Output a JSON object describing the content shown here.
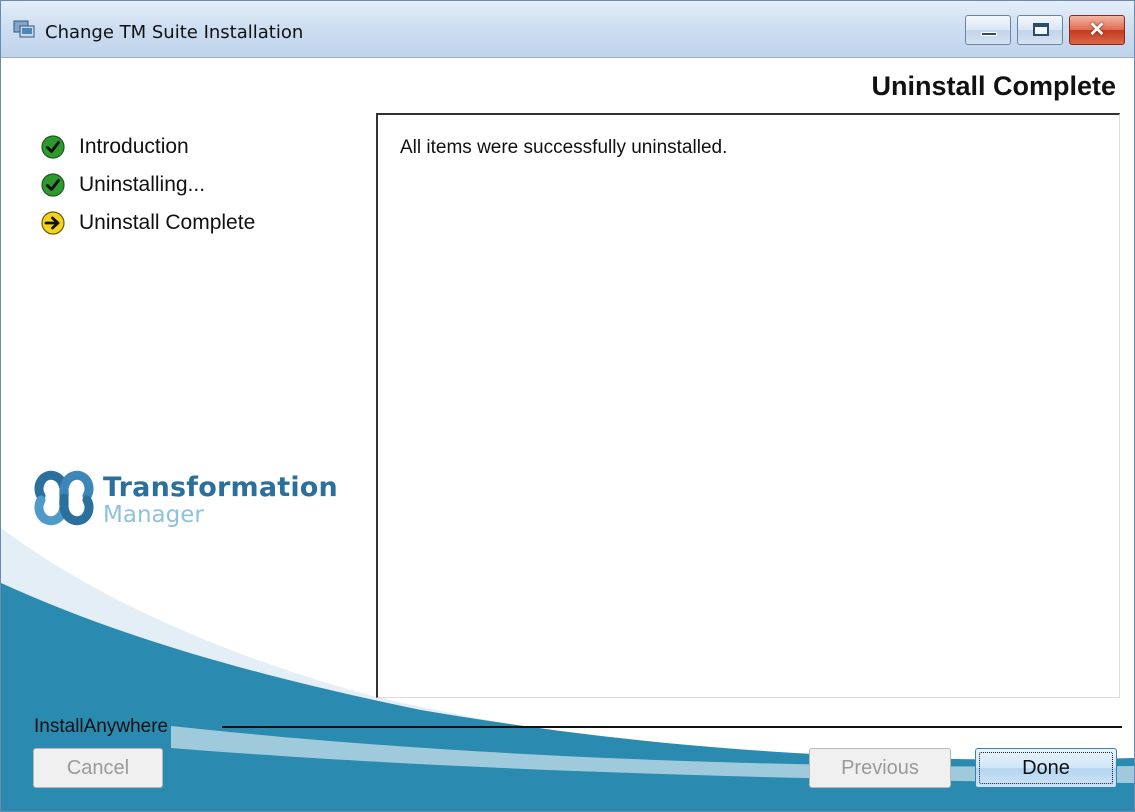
{
  "window": {
    "title": "Change TM Suite Installation",
    "controls": {
      "minimize": "minimize",
      "maximize": "maximize",
      "close": "✕"
    }
  },
  "page": {
    "title": "Uninstall Complete"
  },
  "steps": [
    {
      "label": "Introduction",
      "status": "done",
      "icon": "check-icon"
    },
    {
      "label": "Uninstalling...",
      "status": "done",
      "icon": "check-icon"
    },
    {
      "label": "Uninstall Complete",
      "status": "current",
      "icon": "arrow-right-icon"
    }
  ],
  "logo": {
    "line1": "Transformation",
    "line2": "Manager"
  },
  "content": {
    "message": "All items were successfully uninstalled."
  },
  "footer": {
    "brand": "InstallAnywhere",
    "cancel_label": "Cancel",
    "previous_label": "Previous",
    "done_label": "Done"
  },
  "colors": {
    "check": "#2e9a2e",
    "arrow": "#f2d41c",
    "swoosh": "#2b8ab0",
    "logo_primary": "#2b6f9c",
    "logo_secondary": "#8ec1de"
  }
}
